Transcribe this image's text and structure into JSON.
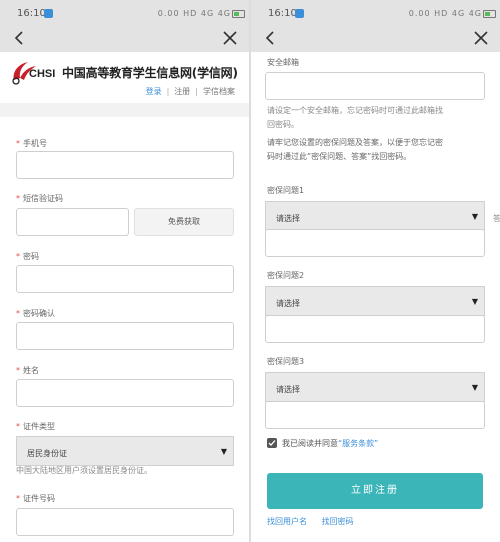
{
  "status": {
    "time": "16:10",
    "indicators": "0.00 HD 4G 4G"
  },
  "header": {
    "logo_text": "CHSI",
    "site_title": "中国高等教育学生信息网(学信网)",
    "links": [
      "登录",
      "注册",
      "学信档案"
    ]
  },
  "form": {
    "mobile_label": "手机号",
    "code_label": "短信验证码",
    "code_button": "免费获取",
    "password_label": "密码",
    "password_confirm_label": "密码确认",
    "name_label": "姓名",
    "id_type_label": "证件类型",
    "id_type_value": "居民身份证",
    "id_type_hint": "中国大陆地区用户须设置居民身份证。",
    "id_number_label": "证件号码"
  },
  "security": {
    "email_label": "安全邮箱",
    "email_hint_1": "请设定一个安全邮箱，忘记密码时可通过此邮箱找",
    "email_hint_2": "回密码。",
    "questions_hint_1": "请牢记您设置的密保问题及答案，以便于您忘记密",
    "questions_hint_2": "码时通过此“密保问题、答案”找回密码。",
    "question1_label": "密保问题1",
    "question2_label": "密保问题2",
    "question3_label": "密保问题3",
    "select_placeholder": "请选择",
    "side_glyph": "答"
  },
  "agreement": {
    "prefix": "我已阅读并同意",
    "terms": "“服务条款”"
  },
  "submit_label": "立即注册",
  "bottom_links": {
    "recover_user": "找回用户名",
    "recover_password": "找回密码"
  },
  "colors": {
    "accent": "#3a8fd8",
    "submit": "#3bb5b8",
    "required": "#e05050"
  }
}
